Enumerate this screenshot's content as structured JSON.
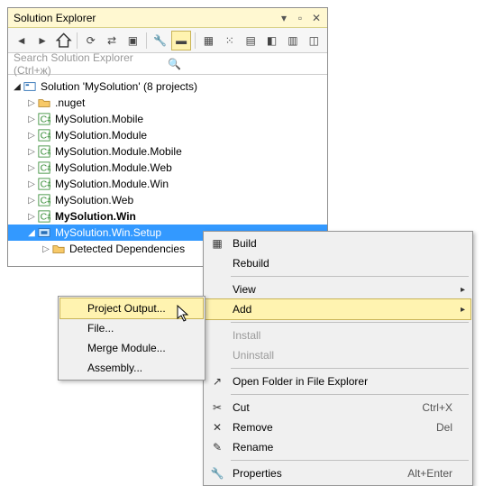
{
  "panel": {
    "title": "Solution Explorer",
    "search_placeholder": "Search Solution Explorer (Ctrl+ж)"
  },
  "tree": {
    "root": "Solution 'MySolution' (8 projects)",
    "items": [
      ".nuget",
      "MySolution.Mobile",
      "MySolution.Module",
      "MySolution.Module.Mobile",
      "MySolution.Module.Web",
      "MySolution.Module.Win",
      "MySolution.Web",
      "MySolution.Win",
      "MySolution.Win.Setup"
    ],
    "selected_child": "Detected Dependencies"
  },
  "context_main": {
    "build": "Build",
    "rebuild": "Rebuild",
    "view": "View",
    "add": "Add",
    "install": "Install",
    "uninstall": "Uninstall",
    "open_folder": "Open Folder in File Explorer",
    "cut": "Cut",
    "cut_sc": "Ctrl+X",
    "remove": "Remove",
    "remove_sc": "Del",
    "rename": "Rename",
    "properties": "Properties",
    "properties_sc": "Alt+Enter"
  },
  "context_add": {
    "project_output": "Project Output...",
    "file": "File...",
    "merge_module": "Merge Module...",
    "assembly": "Assembly..."
  }
}
